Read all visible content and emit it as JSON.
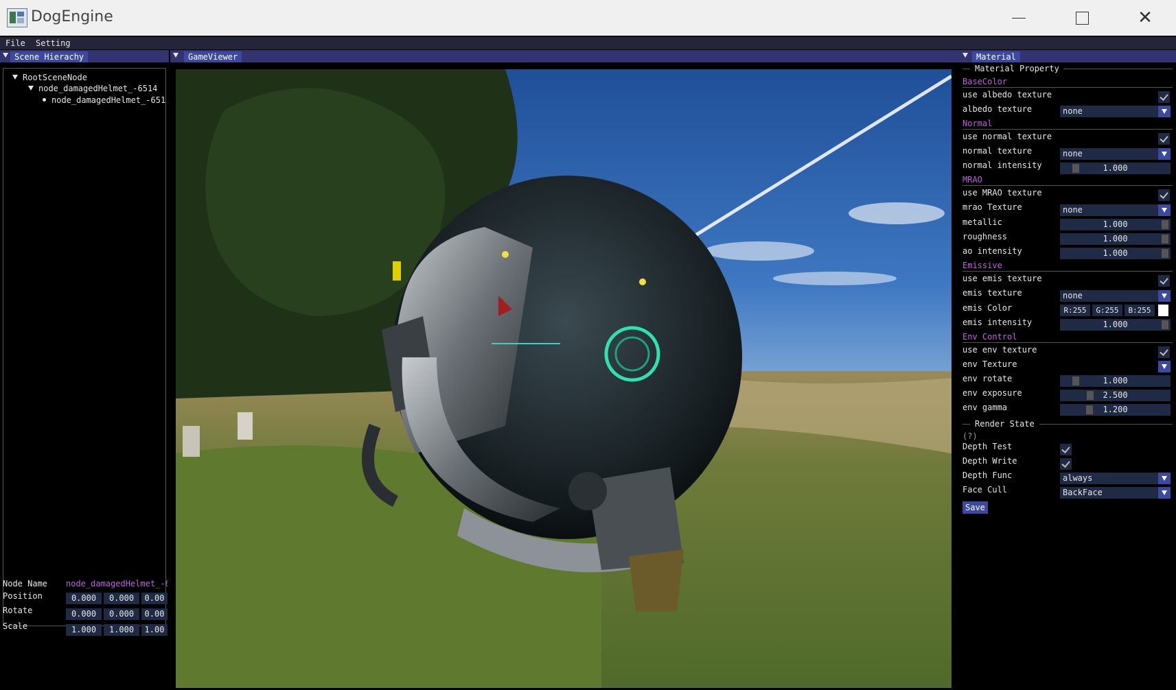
{
  "window": {
    "title": "DogEngine",
    "min_icon": "minimize-icon",
    "max_icon": "maximize-icon",
    "close_icon": "close-icon",
    "close_glyph": "✕"
  },
  "menu": [
    "File",
    "Setting"
  ],
  "scene": {
    "tab": "Scene Hierachy",
    "tree": [
      "RootSceneNode",
      "node_damagedHelmet_-6514",
      "node_damagedHelmet_-651"
    ],
    "node_name_label": "Node Name",
    "node_name_value": "node_damagedHelmet_-6",
    "props": [
      {
        "label": "Position",
        "values": [
          "0.000",
          "0.000",
          "0.00"
        ]
      },
      {
        "label": "Rotate",
        "values": [
          "0.000",
          "0.000",
          "0.00"
        ]
      },
      {
        "label": "Scale",
        "values": [
          "1.000",
          "1.000",
          "1.00"
        ]
      }
    ]
  },
  "game": {
    "tab": "GameViewer",
    "scene_content": "3d-render-damaged-helmet"
  },
  "material": {
    "tab": "Material",
    "material_property": "Material Property",
    "base_color": "BaseColor",
    "use_albedo_texture": "use albedo texture",
    "albedo_texture": "albedo texture",
    "albedo_value": "none",
    "normal": "Normal",
    "use_normal_texture": "use normal texture",
    "normal_texture": "normal texture",
    "normal_value": "none",
    "normal_intensity": "normal intensity",
    "normal_intensity_value": "1.000",
    "mrao": "MRAO",
    "use_mrao_texture": "use MRAO texture",
    "mrao_texture": "mrao Texture",
    "mrao_value": "none",
    "metallic": "metallic",
    "metallic_value": "1.000",
    "roughness": "roughness",
    "roughness_value": "1.000",
    "ao_intensity": "ao intensity",
    "ao_value": "1.000",
    "emissive": "Emissive",
    "use_emis_texture": "use emis texture",
    "emis_texture": "emis texture",
    "emis_value": "none",
    "emis_color": "emis Color",
    "emis_r": "R:255",
    "emis_g": "G:255",
    "emis_b": "B:255",
    "emis_intensity": "emis intensity",
    "emis_intensity_value": "1.000",
    "env_control": "Env Control",
    "use_env_texture": "use env texture",
    "env_texture": "env Texture",
    "env_rotate": "env rotate",
    "env_rotate_value": "1.000",
    "env_exposure": "env exposure",
    "env_exposure_value": "2.500",
    "env_gamma": "env gamma",
    "env_gamma_value": "1.200",
    "render_state": "Render State",
    "help": "(?)",
    "depth_test": "Depth Test",
    "depth_write": "Depth Write",
    "depth_func": "Depth Func",
    "depth_func_value": "always",
    "face_cull": "Face Cull",
    "face_cull_value": "BackFace",
    "save": "Save",
    "accent_color": "#3b4aa0",
    "section_color": "#c060e0"
  }
}
